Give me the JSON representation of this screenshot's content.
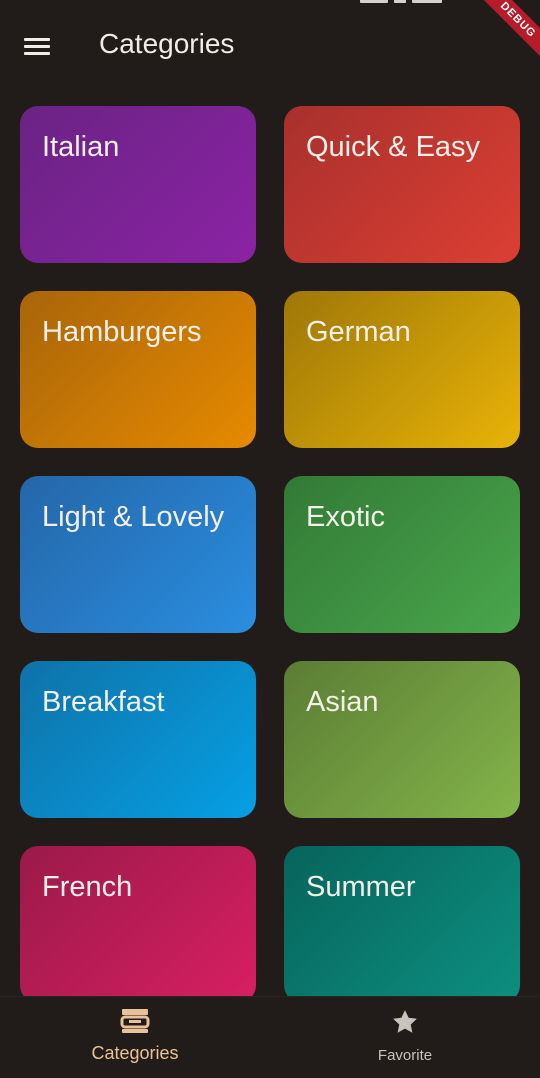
{
  "app_bar": {
    "title": "Categories"
  },
  "debug_banner": "DEBUG",
  "categories": [
    {
      "label": "Italian",
      "from": "#6a2384",
      "to": "#8b23a4"
    },
    {
      "label": "Quick & Easy",
      "from": "#a8302d",
      "to": "#dc3f33"
    },
    {
      "label": "Hamburgers",
      "from": "#a8650a",
      "to": "#e68a00"
    },
    {
      "label": "German",
      "from": "#9e7708",
      "to": "#e8b308"
    },
    {
      "label": "Light & Lovely",
      "from": "#2566a8",
      "to": "#2a8ee0"
    },
    {
      "label": "Exotic",
      "from": "#327a37",
      "to": "#4aa64c"
    },
    {
      "label": "Breakfast",
      "from": "#0f72a8",
      "to": "#06a0e4"
    },
    {
      "label": "Asian",
      "from": "#5b7d35",
      "to": "#84b44a"
    },
    {
      "label": "French",
      "from": "#9a1a48",
      "to": "#d81f62"
    },
    {
      "label": "Summer",
      "from": "#07645c",
      "to": "#0d8f80"
    }
  ],
  "bottom_nav": {
    "items": [
      {
        "label": "Categories",
        "icon": "categories-icon",
        "active": true
      },
      {
        "label": "Favorite",
        "icon": "star-icon",
        "active": false
      }
    ],
    "active_color": "#e9c29a",
    "inactive_color": "#c9c3be"
  }
}
